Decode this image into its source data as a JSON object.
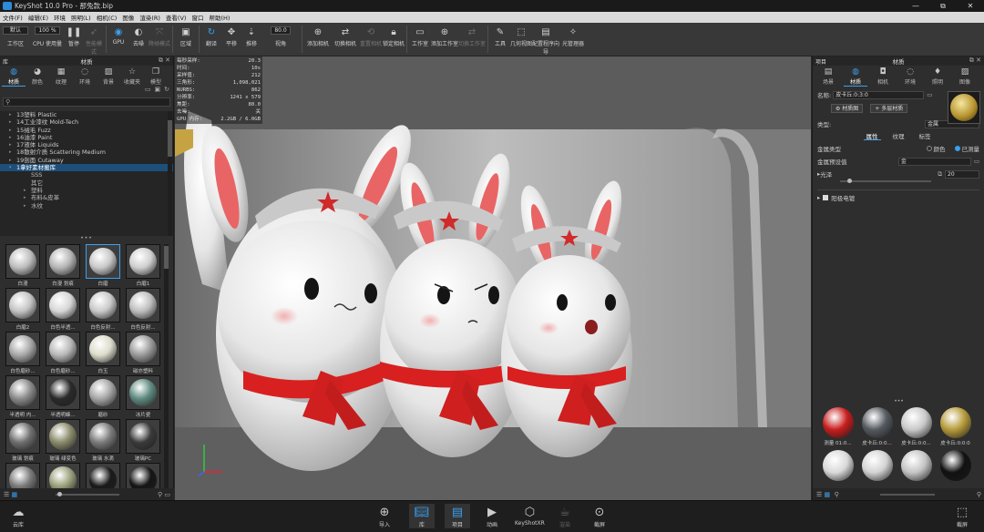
{
  "window": {
    "title": "KeyShot 10.0 Pro - 那兔款.bip",
    "controls": [
      "—",
      "⧉",
      "✕"
    ]
  },
  "menu": [
    "文件(F)",
    "编辑(E)",
    "环境",
    "照明(L)",
    "相机(C)",
    "图像",
    "渲染(R)",
    "查看(V)",
    "窗口",
    "帮助(H)"
  ],
  "toolbar": {
    "workspace_label": "工作区",
    "workspace_value": "默认",
    "cpu_label": "CPU 使用量",
    "cpu_value": "100 %",
    "items": [
      {
        "label": "暂停",
        "icon": "pause-icon"
      },
      {
        "label": "性能模式",
        "icon": "rocket-icon",
        "dim": true
      },
      {
        "label": "GPU",
        "icon": "gpu-icon",
        "active": true
      },
      {
        "label": "去噪",
        "icon": "denoise-icon"
      },
      {
        "label": "降帧模式",
        "icon": "frame-icon",
        "dim": true
      },
      {
        "label": "区域",
        "icon": "region-icon"
      },
      {
        "label": "翻译",
        "icon": "refresh-icon",
        "active": true
      },
      {
        "label": "平移",
        "icon": "move-icon"
      },
      {
        "label": "推移",
        "icon": "dolly-icon"
      },
      {
        "label": "视角",
        "icon": "fov-icon"
      },
      {
        "label": "添加相机",
        "icon": "camera-add-icon"
      },
      {
        "label": "切换相机",
        "icon": "camera-switch-icon"
      },
      {
        "label": "重置相机",
        "icon": "camera-reset-icon",
        "dim": true
      },
      {
        "label": "锁定相机",
        "icon": "camera-lock-icon"
      },
      {
        "label": "工作室",
        "icon": "studio-icon"
      },
      {
        "label": "添加工作室",
        "icon": "studio-add-icon"
      },
      {
        "label": "切换工作室",
        "icon": "studio-switch-icon",
        "dim": true
      },
      {
        "label": "工具",
        "icon": "tools-icon"
      },
      {
        "label": "几何视图",
        "icon": "geometry-icon"
      },
      {
        "label": "配置程序向导",
        "icon": "wizard-icon"
      },
      {
        "label": "光管理器",
        "icon": "light-icon"
      }
    ],
    "fov_value": "80.0"
  },
  "left_panel": {
    "title": "材质",
    "side_label": "库",
    "tabs": [
      {
        "label": "材质",
        "icon": "material-icon",
        "active": true
      },
      {
        "label": "颜色",
        "icon": "color-icon"
      },
      {
        "label": "纹理",
        "icon": "texture-icon"
      },
      {
        "label": "环境",
        "icon": "environment-icon"
      },
      {
        "label": "背景",
        "icon": "background-icon"
      },
      {
        "label": "收藏夹",
        "icon": "star-icon"
      },
      {
        "label": "模型",
        "icon": "model-icon"
      }
    ],
    "tree": [
      "13塑料 Plastic",
      "14工业漆纹 Mold-Tech",
      "15绒毛 Fuzz",
      "16油漆 Paint",
      "17液体 Liquids",
      "18散射介质 Scattering Medium",
      "19剖面 Cutaway"
    ],
    "tree_selected": "1拿好素材搬库",
    "tree_children": [
      "SSS",
      "其它",
      "塑料",
      "布料&皮革",
      "水纹"
    ],
    "materials": [
      {
        "label": "白漫",
        "color": "#bdbdbd"
      },
      {
        "label": "白漫 划痕",
        "color": "#b5b5b5"
      },
      {
        "label": "白磨",
        "color": "#c8c8c8",
        "sel": true
      },
      {
        "label": "白磨1",
        "color": "#cfcfcf"
      },
      {
        "label": "白磨2",
        "color": "#c4c4c4"
      },
      {
        "label": "白色半透...",
        "color": "#d6d6d6"
      },
      {
        "label": "白色反射...",
        "color": "#c9c9c9"
      },
      {
        "label": "白色反射...",
        "color": "#bebebe"
      },
      {
        "label": "白色磨砂...",
        "color": "#a8a8a8"
      },
      {
        "label": "白色磨砂...",
        "color": "#b8b8b8"
      },
      {
        "label": "白玉",
        "color": "#dcdccc"
      },
      {
        "label": "磁亦塑料",
        "color": "#9a9a9a"
      },
      {
        "label": "半透明 内...",
        "color": "#8a8a8a"
      },
      {
        "label": "半透明蜂...",
        "color": "#2a2a2a"
      },
      {
        "label": "磨砂",
        "color": "#a5a5a5"
      },
      {
        "label": "冰片瓷",
        "color": "#5f8a80"
      },
      {
        "label": "玻璃 划痕",
        "color": "#6e6e6e"
      },
      {
        "label": "玻璃 绿变色",
        "color": "#8a8a6a"
      },
      {
        "label": "玻璃 水滴",
        "color": "#7a7a7a"
      },
      {
        "label": "玻璃PC",
        "color": "#3a3a3a"
      },
      {
        "label": "",
        "color": "#7a7a7a"
      },
      {
        "label": "",
        "color": "#9aa07a"
      },
      {
        "label": "",
        "color": "#1a1a1a"
      },
      {
        "label": "",
        "color": "#151515"
      }
    ]
  },
  "viewport": {
    "stats": [
      [
        "每秒采样:",
        "20.3"
      ],
      [
        "时间:",
        "10s"
      ],
      [
        "采样值:",
        "212"
      ],
      [
        "三角形:",
        "1,098,021"
      ],
      [
        "NURBS:",
        "862"
      ],
      [
        "分辨率:",
        "1241 x 579"
      ],
      [
        "焦距:",
        "80.0"
      ],
      [
        "去噪:",
        "关"
      ],
      [
        "GPU 内存:",
        "2.2GB / 6.0GB"
      ]
    ]
  },
  "right_panel": {
    "title": "材质",
    "side_label": "项目",
    "tabs": [
      {
        "label": "场景",
        "icon": "scene-icon"
      },
      {
        "label": "材质",
        "icon": "material-icon",
        "active": true
      },
      {
        "label": "相机",
        "icon": "camera-icon"
      },
      {
        "label": "环境",
        "icon": "environment-icon"
      },
      {
        "label": "照明",
        "icon": "bulb-icon"
      },
      {
        "label": "图像",
        "icon": "image-icon"
      }
    ],
    "name_label": "名称:",
    "name_value": "皮卡丘:0:3:0",
    "material_graph": "材质图",
    "multi_layer": "多层材质",
    "type_label": "类型:",
    "type_value": "金属",
    "subtabs": [
      "属性",
      "纹理",
      "标签"
    ],
    "metal_type_label": "金属类型",
    "metal_types": [
      "颜色",
      "已测量"
    ],
    "metal_preset_label": "金属预设值",
    "metal_preset_value": "金",
    "roughness_label": "光泽",
    "roughness_value": "20",
    "aniso_label": "粗糙度",
    "aniso_label2": "阳极电镀",
    "swatches": [
      {
        "label": "测量 01:0...",
        "color": "#c81d1d"
      },
      {
        "label": "皮卡丘:0:0...",
        "color": "#555a60"
      },
      {
        "label": "皮卡丘:0:0...",
        "color": "#c9c9c9"
      },
      {
        "label": "皮卡丘:0:0:0",
        "color": "#b69a3a"
      },
      {
        "label": "",
        "color": "#d9d9d9"
      },
      {
        "label": "",
        "color": "#d3d3d3"
      },
      {
        "label": "",
        "color": "#c4c4c4"
      },
      {
        "label": "",
        "color": "#111111"
      }
    ]
  },
  "statusbar": [
    {
      "label": "云库",
      "icon": "cloud-icon"
    },
    {
      "label": "导入",
      "icon": "import-icon"
    },
    {
      "label": "库",
      "icon": "library-icon",
      "active": true
    },
    {
      "label": "项目",
      "icon": "project-icon",
      "active": true
    },
    {
      "label": "动画",
      "icon": "play-icon"
    },
    {
      "label": "KeyShotXR",
      "icon": "cube-icon"
    },
    {
      "label": "渲染",
      "icon": "render-icon",
      "dim": true
    },
    {
      "label": "截屏",
      "icon": "screenshot-icon"
    }
  ],
  "statusbar_right": "截屏"
}
